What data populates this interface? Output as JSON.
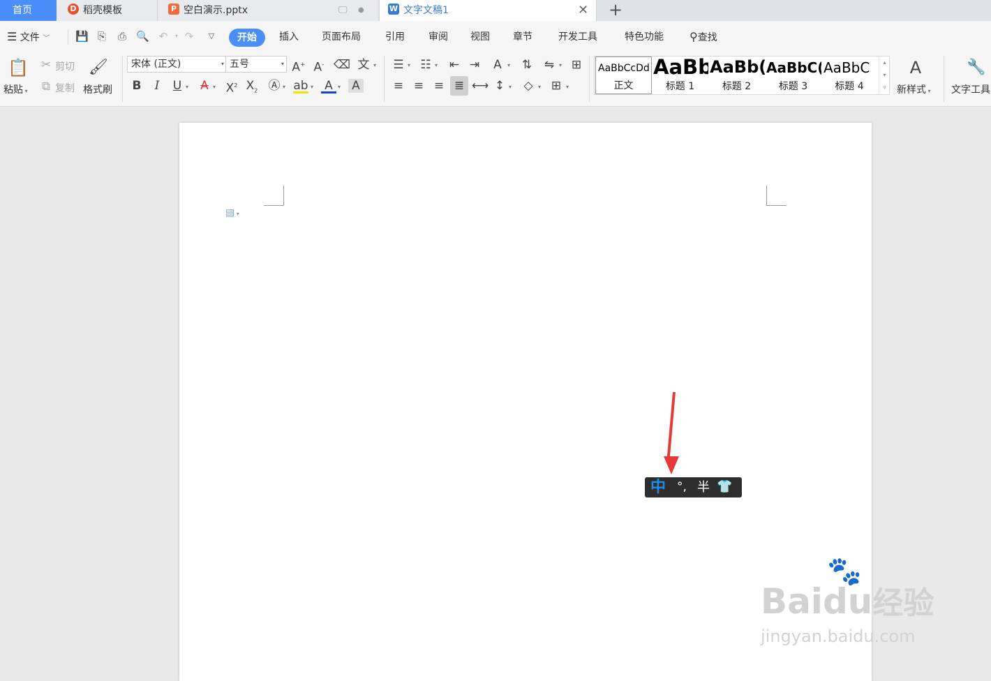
{
  "tabs": {
    "home": "首页",
    "daoke": "稻壳模板",
    "pptx": "空白演示.pptx",
    "doc": "文字文稿1",
    "new": "+"
  },
  "menu": {
    "file": "文件",
    "items": [
      "开始",
      "插入",
      "页面布局",
      "引用",
      "审阅",
      "视图",
      "章节",
      "开发工具",
      "特色功能"
    ],
    "search": "查找"
  },
  "ribbon": {
    "paste": "粘贴",
    "cut": "剪切",
    "copy": "复制",
    "format_painter": "格式刷",
    "font_name": "宋体 (正文)",
    "font_size": "五号",
    "styles": [
      {
        "sample": "AaBbCcDd",
        "name": "正文"
      },
      {
        "sample": "AaBb",
        "name": "标题 1"
      },
      {
        "sample": "AaBb(",
        "name": "标题 2"
      },
      {
        "sample": "AaBbC(",
        "name": "标题 3"
      },
      {
        "sample": "AaBbC",
        "name": "标题 4"
      }
    ],
    "new_style": "新样式",
    "text_tools": "文字工具"
  },
  "ime": {
    "mode": "中",
    "punct": "°,",
    "width": "半"
  },
  "watermark": {
    "brand": "Bai",
    "brand2": "du",
    "cn": "经验",
    "url": "jingyan.baidu.com"
  },
  "colors": {
    "accent": "#4a8ef7",
    "arrow": "#e53935",
    "ime_bg": "#2e2e2e"
  }
}
